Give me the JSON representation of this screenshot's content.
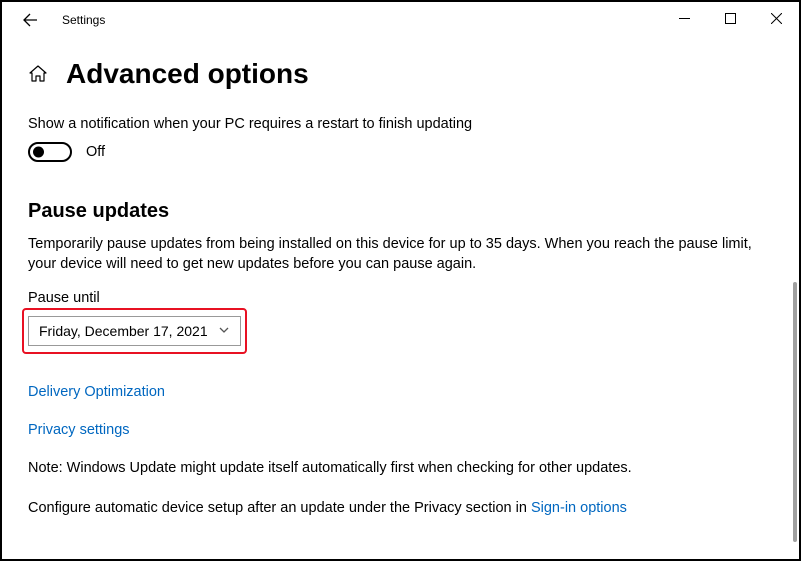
{
  "titlebar": {
    "title": "Settings"
  },
  "page": {
    "title": "Advanced options",
    "notification_desc": "Show a notification when your PC requires a restart to finish updating",
    "toggle_state": "Off"
  },
  "pause": {
    "heading": "Pause updates",
    "desc": "Temporarily pause updates from being installed on this device for up to 35 days. When you reach the pause limit, your device will need to get new updates before you can pause again.",
    "field_label": "Pause until",
    "selected_date": "Friday, December 17, 2021"
  },
  "links": {
    "delivery": "Delivery Optimization",
    "privacy": "Privacy settings"
  },
  "footer": {
    "note": "Note: Windows Update might update itself automatically first when checking for other updates.",
    "configure_prefix": "Configure automatic device setup after an update under the Privacy section in ",
    "signin_link": "Sign-in options"
  }
}
